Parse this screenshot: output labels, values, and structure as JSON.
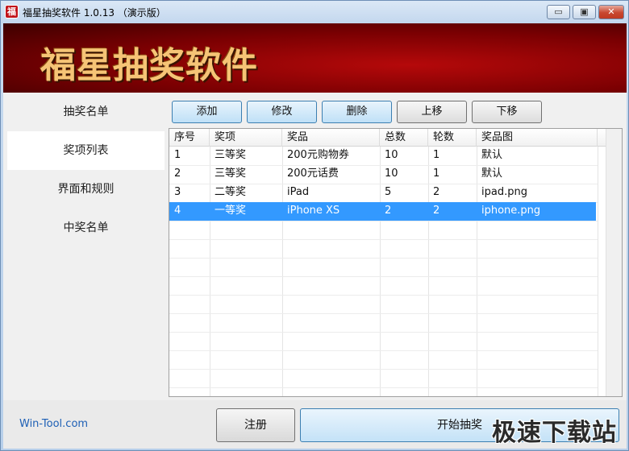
{
  "titlebar": {
    "icon_glyph": "福",
    "title": "福星抽奖软件 1.0.13 （演示版）",
    "minimize": "▭",
    "maximize": "▣",
    "close": "✕"
  },
  "banner": {
    "title": "福星抽奖软件"
  },
  "sidebar": {
    "items": [
      {
        "label": "抽奖名单"
      },
      {
        "label": "奖项列表",
        "active": true
      },
      {
        "label": "界面和规则"
      },
      {
        "label": "中奖名单"
      }
    ]
  },
  "toolbar": {
    "add": "添加",
    "edit": "修改",
    "delete": "删除",
    "move_up": "上移",
    "move_down": "下移"
  },
  "table": {
    "columns": [
      "序号",
      "奖项",
      "奖品",
      "总数",
      "轮数",
      "奖品图"
    ],
    "rows": [
      [
        "1",
        "三等奖",
        "200元购物券",
        "10",
        "1",
        "默认"
      ],
      [
        "2",
        "三等奖",
        "200元话费",
        "10",
        "1",
        "默认"
      ],
      [
        "3",
        "二等奖",
        "iPad",
        "5",
        "2",
        "ipad.png"
      ],
      [
        "4",
        "一等奖",
        "iPhone XS",
        "2",
        "2",
        "iphone.png"
      ]
    ],
    "selected_row": 3
  },
  "footer": {
    "link": "Win-Tool.com",
    "register": "注册",
    "start": "开始抽奖"
  },
  "watermark": "极速下载站",
  "colors": {
    "selection": "#3399ff",
    "banner_red": "#8a0003",
    "banner_text": "#f6c476",
    "link": "#1d5fb5"
  }
}
